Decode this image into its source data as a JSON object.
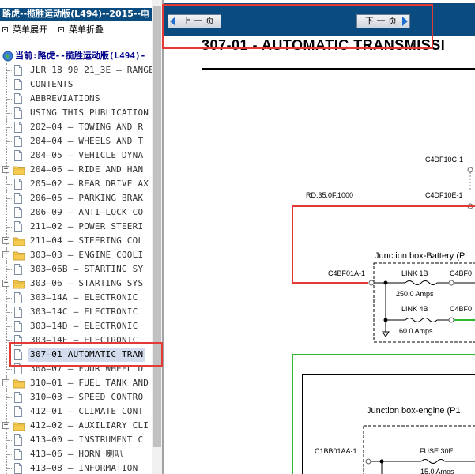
{
  "left_pane": {
    "title": "路虎--揽胜运动版(L494)--2015--电",
    "toolbar": {
      "expand_label": "菜单展开",
      "collapse_label": "菜单折叠"
    },
    "root_label": "当前:路虎--揽胜运动版(L494)-",
    "items": [
      {
        "label": "JLR 18 90 21_3E — RANGE",
        "type": "doc"
      },
      {
        "label": "CONTENTS",
        "type": "doc"
      },
      {
        "label": "ABBREVIATIONS",
        "type": "doc"
      },
      {
        "label": "USING THIS PUBLICATION",
        "type": "doc"
      },
      {
        "label": "202—04 — TOWING AND R",
        "type": "doc"
      },
      {
        "label": "204—04 — WHEELS AND T",
        "type": "doc"
      },
      {
        "label": "204—05 — VEHICLE DYNA",
        "type": "doc"
      },
      {
        "label": "204—06 — RIDE AND HAN",
        "type": "folder"
      },
      {
        "label": "205—02 — REAR DRIVE AX",
        "type": "doc"
      },
      {
        "label": "206—05 — PARKING BRAK",
        "type": "doc"
      },
      {
        "label": "206—09 — ANTI—LOCK CO",
        "type": "doc"
      },
      {
        "label": "211—02 — POWER STEERI",
        "type": "doc"
      },
      {
        "label": "211—04 — STEERING COL",
        "type": "folder"
      },
      {
        "label": "303—03 — ENGINE COOLI",
        "type": "folder"
      },
      {
        "label": "303—06B — STARTING SY",
        "type": "doc"
      },
      {
        "label": "303—06 — STARTING SYS",
        "type": "folder"
      },
      {
        "label": "303—14A — ELECTRONIC",
        "type": "doc"
      },
      {
        "label": "303—14C — ELECTRONIC",
        "type": "doc"
      },
      {
        "label": "303—14D — ELECTRONIC",
        "type": "doc"
      },
      {
        "label": "303—14E — ELECTRONIC",
        "type": "doc"
      },
      {
        "label": "307—01 AUTOMATIC TRAN",
        "type": "doc",
        "selected": true
      },
      {
        "label": "308—07 — FOUR WHEEL D",
        "type": "doc"
      },
      {
        "label": "310—01 — FUEL TANK AND",
        "type": "folder"
      },
      {
        "label": "310—03 — SPEED CONTRO",
        "type": "doc"
      },
      {
        "label": "412—01 — CLIMATE CONT",
        "type": "doc"
      },
      {
        "label": "412—02 — AUXILIARY CLI",
        "type": "folder"
      },
      {
        "label": "413—00 — INSTRUMENT C",
        "type": "doc"
      },
      {
        "label": "413—06 — HORN 喇叭",
        "type": "doc"
      },
      {
        "label": "413—08 — INFORMATION",
        "type": "doc"
      }
    ]
  },
  "nav": {
    "prev_label": "上 一 页",
    "next_label": "下 一 页"
  },
  "document": {
    "title": "307-01 - AUTOMATIC TRANSMISSI",
    "labels": {
      "c4df10c": "C4DF10C-1",
      "c4df10e": "C4DF10E-1",
      "wire_top": "RD,35.0F,1000",
      "junction_battery": "Junction box-Battery (P",
      "c4bf01a": "C4BF01A-1",
      "c4bf0_a": "C4BF0",
      "c4bf0_b": "C4BF0",
      "link1b": "LINK 1B",
      "link1b_amps": "250.0 Amps",
      "link4b": "LINK 4B",
      "link4b_amps": "60.0 Amps",
      "junction_engine": "Junction box-engine (P1",
      "c1bb01aa": "C1BB01AA-1",
      "fuse30e": "FUSE 30E",
      "fuse30e_amps": "15.0 Amps"
    }
  },
  "colors": {
    "header_blue": "#0a4b80",
    "wire_red": "#e53935",
    "wire_green": "#2db82d",
    "highlight_red": "#e53935"
  }
}
